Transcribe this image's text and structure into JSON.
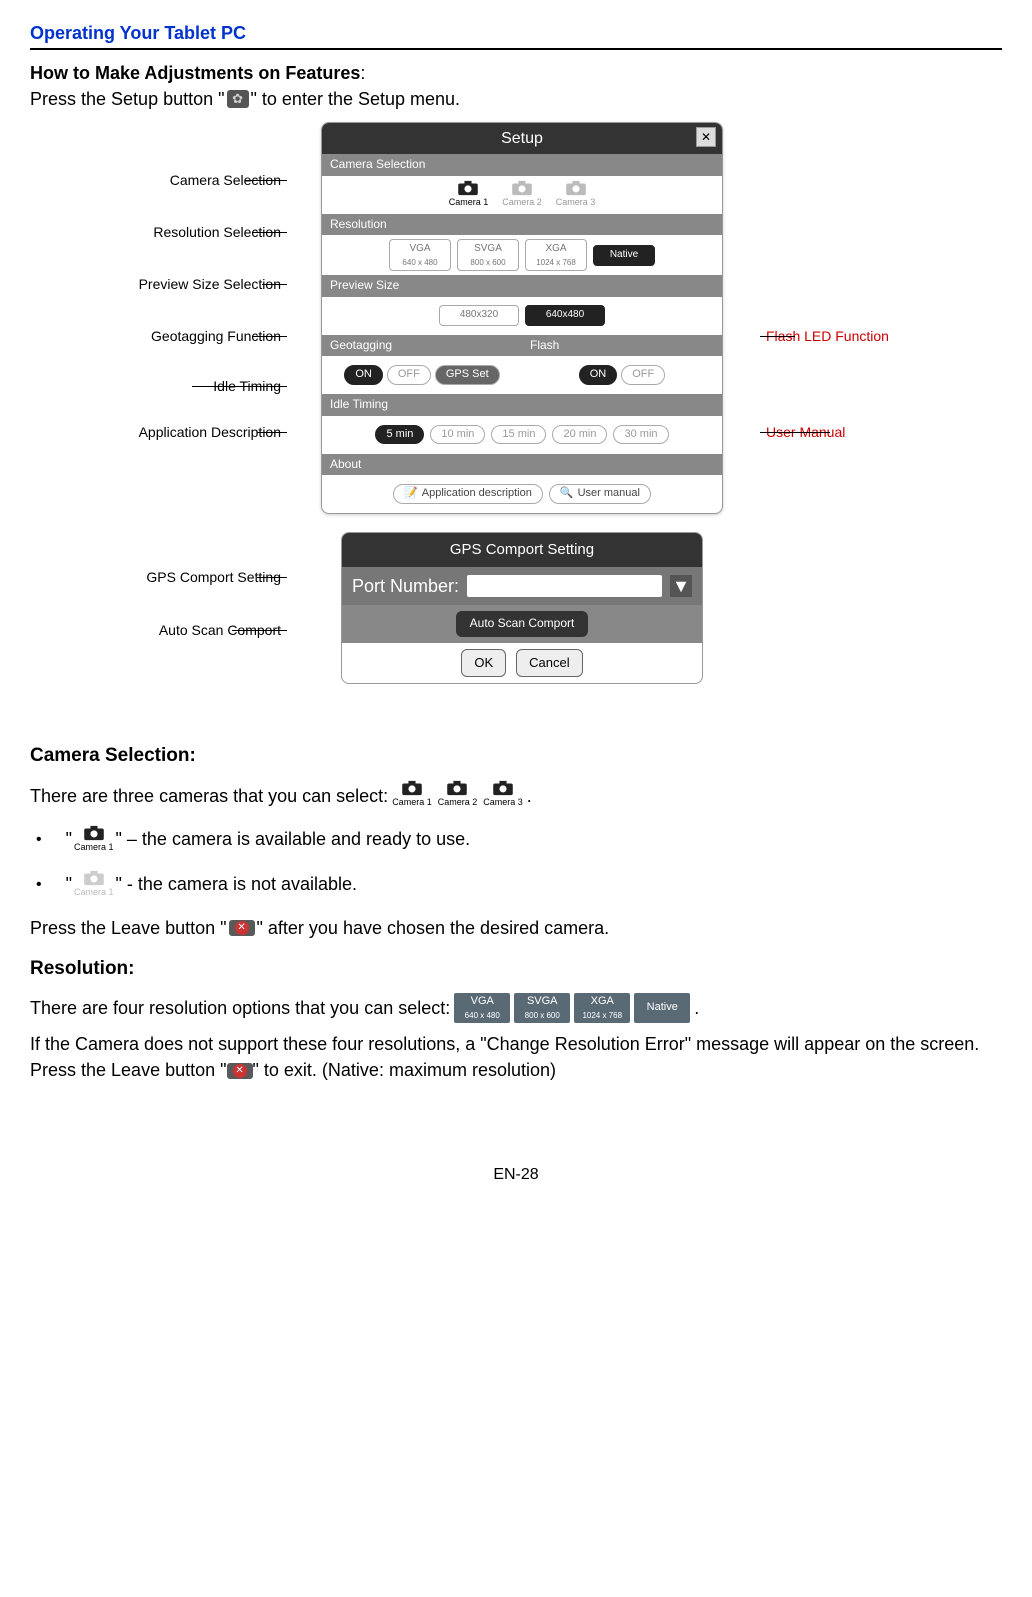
{
  "page": {
    "header": "Operating Your Tablet PC",
    "heading": "How to Make Adjustments on Features",
    "intro_a": "Press the Setup button \"",
    "intro_b": "\" to enter the Setup menu.",
    "footer": "EN-28"
  },
  "diagram": {
    "setup_title": "Setup",
    "sections": {
      "camera_selection": "Camera Selection",
      "resolution": "Resolution",
      "preview_size": "Preview Size",
      "geotagging": "Geotagging",
      "flash": "Flash",
      "idle_timing": "Idle Timing",
      "about": "About"
    },
    "camera_opts": [
      "Camera 1",
      "Camera 2",
      "Camera 3"
    ],
    "res_opts": [
      {
        "t": "VGA",
        "s": "640 x 480"
      },
      {
        "t": "SVGA",
        "s": "800 x 600"
      },
      {
        "t": "XGA",
        "s": "1024 x 768"
      },
      {
        "t": "Native",
        "s": ""
      }
    ],
    "preview_opts": [
      "480x320",
      "640x480"
    ],
    "on": "ON",
    "off": "OFF",
    "gps_set": "GPS Set",
    "idle_opts": [
      "5 min",
      "10 min",
      "15 min",
      "20 min",
      "30 min"
    ],
    "about_opts": [
      "Application description",
      "User manual"
    ],
    "gps_panel": {
      "title": "GPS Comport Setting",
      "port_label": "Port Number:",
      "auto": "Auto Scan Comport",
      "ok": "OK",
      "cancel": "Cancel"
    },
    "left_callouts": [
      "Camera Selection",
      "Resolution Selection",
      "Preview Size Selection",
      "Geotagging Function",
      "Idle Timing",
      "Application Description",
      "GPS Comport Setting",
      "Auto Scan Comport"
    ],
    "right_callouts": [
      "Flash LED Function",
      "User Manual"
    ]
  },
  "camera_section": {
    "title": "Camera Selection:",
    "intro": "There are three cameras that you can select: ",
    "cam_labels": [
      "Camera 1",
      "Camera 2",
      "Camera 3"
    ],
    "dot": ".",
    "q": "\"",
    "bullet1_after": "\" – the camera is available and ready to use.",
    "bullet2_after": "\"  - the camera is not available.",
    "leave_a": "Press the Leave button \"",
    "leave_b": "\" after you have chosen the desired camera."
  },
  "resolution_section": {
    "title": "Resolution:",
    "intro": "There are four resolution options that you can select: ",
    "dot": ".",
    "chips": [
      {
        "t": "VGA",
        "s": "640 x 480"
      },
      {
        "t": "SVGA",
        "s": "800 x 600"
      },
      {
        "t": "XGA",
        "s": "1024 x 768"
      },
      {
        "t": "Native",
        "s": ""
      }
    ],
    "err_a": "If the Camera does not support these four resolutions, a \"Change Resolution Error\" message will appear on the screen. Press the Leave button \"",
    "err_b": "\" to exit. (Native: maximum resolution)"
  }
}
